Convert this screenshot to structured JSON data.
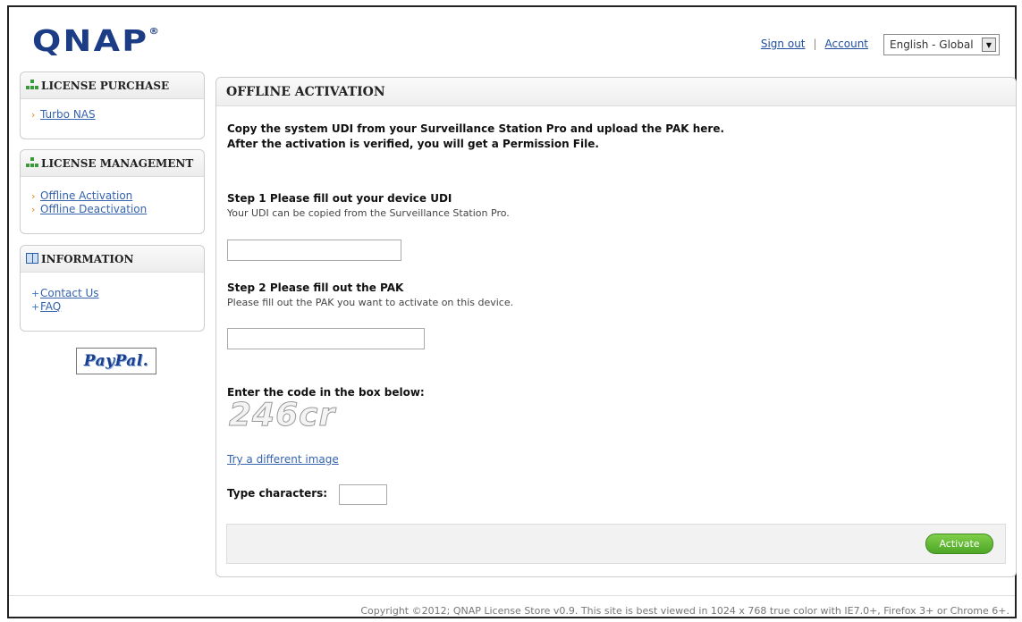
{
  "header": {
    "logo_text": "QNAP",
    "logo_mark": "®",
    "sign_out": "Sign out",
    "separator": "|",
    "account": "Account",
    "language": "English - Global",
    "language_arrow": "▼"
  },
  "sidebar": {
    "purchase": {
      "title": "LICENSE PURCHASE",
      "items": [
        {
          "label": "Turbo NAS"
        }
      ]
    },
    "management": {
      "title": "LICENSE MANAGEMENT",
      "items": [
        {
          "label": "Offline Activation"
        },
        {
          "label": "Offline Deactivation"
        }
      ]
    },
    "information": {
      "title": "INFORMATION",
      "items": [
        {
          "label": "Contact Us"
        },
        {
          "label": "FAQ"
        }
      ]
    },
    "paypal": "PayPal."
  },
  "main": {
    "title": "OFFLINE ACTIVATION",
    "intro_line1": "Copy the system UDI from your Surveillance Station Pro and upload the PAK here.",
    "intro_line2": "After the activation is verified, you will get a Permission File.",
    "step1_title": "Step 1 Please fill out your device UDI",
    "step1_desc": "Your UDI can be copied from the Surveillance Station Pro.",
    "udi_value": "",
    "step2_title": "Step 2 Please fill out the PAK",
    "step2_desc": "Please fill out the PAK you want to activate on this device.",
    "pak_value": "",
    "captcha_prompt": "Enter the code in the box below:",
    "captcha_text": "246cr",
    "try_different": "Try a different image",
    "type_chars_label": "Type characters:",
    "type_chars_value": "",
    "activate_label": "Activate"
  },
  "footer": {
    "copyright": "Copyright ©2012; QNAP License Store v0.9. This site is best viewed in 1024 x 768 true color with IE7.0+, Firefox 3+ or Chrome 6+."
  }
}
